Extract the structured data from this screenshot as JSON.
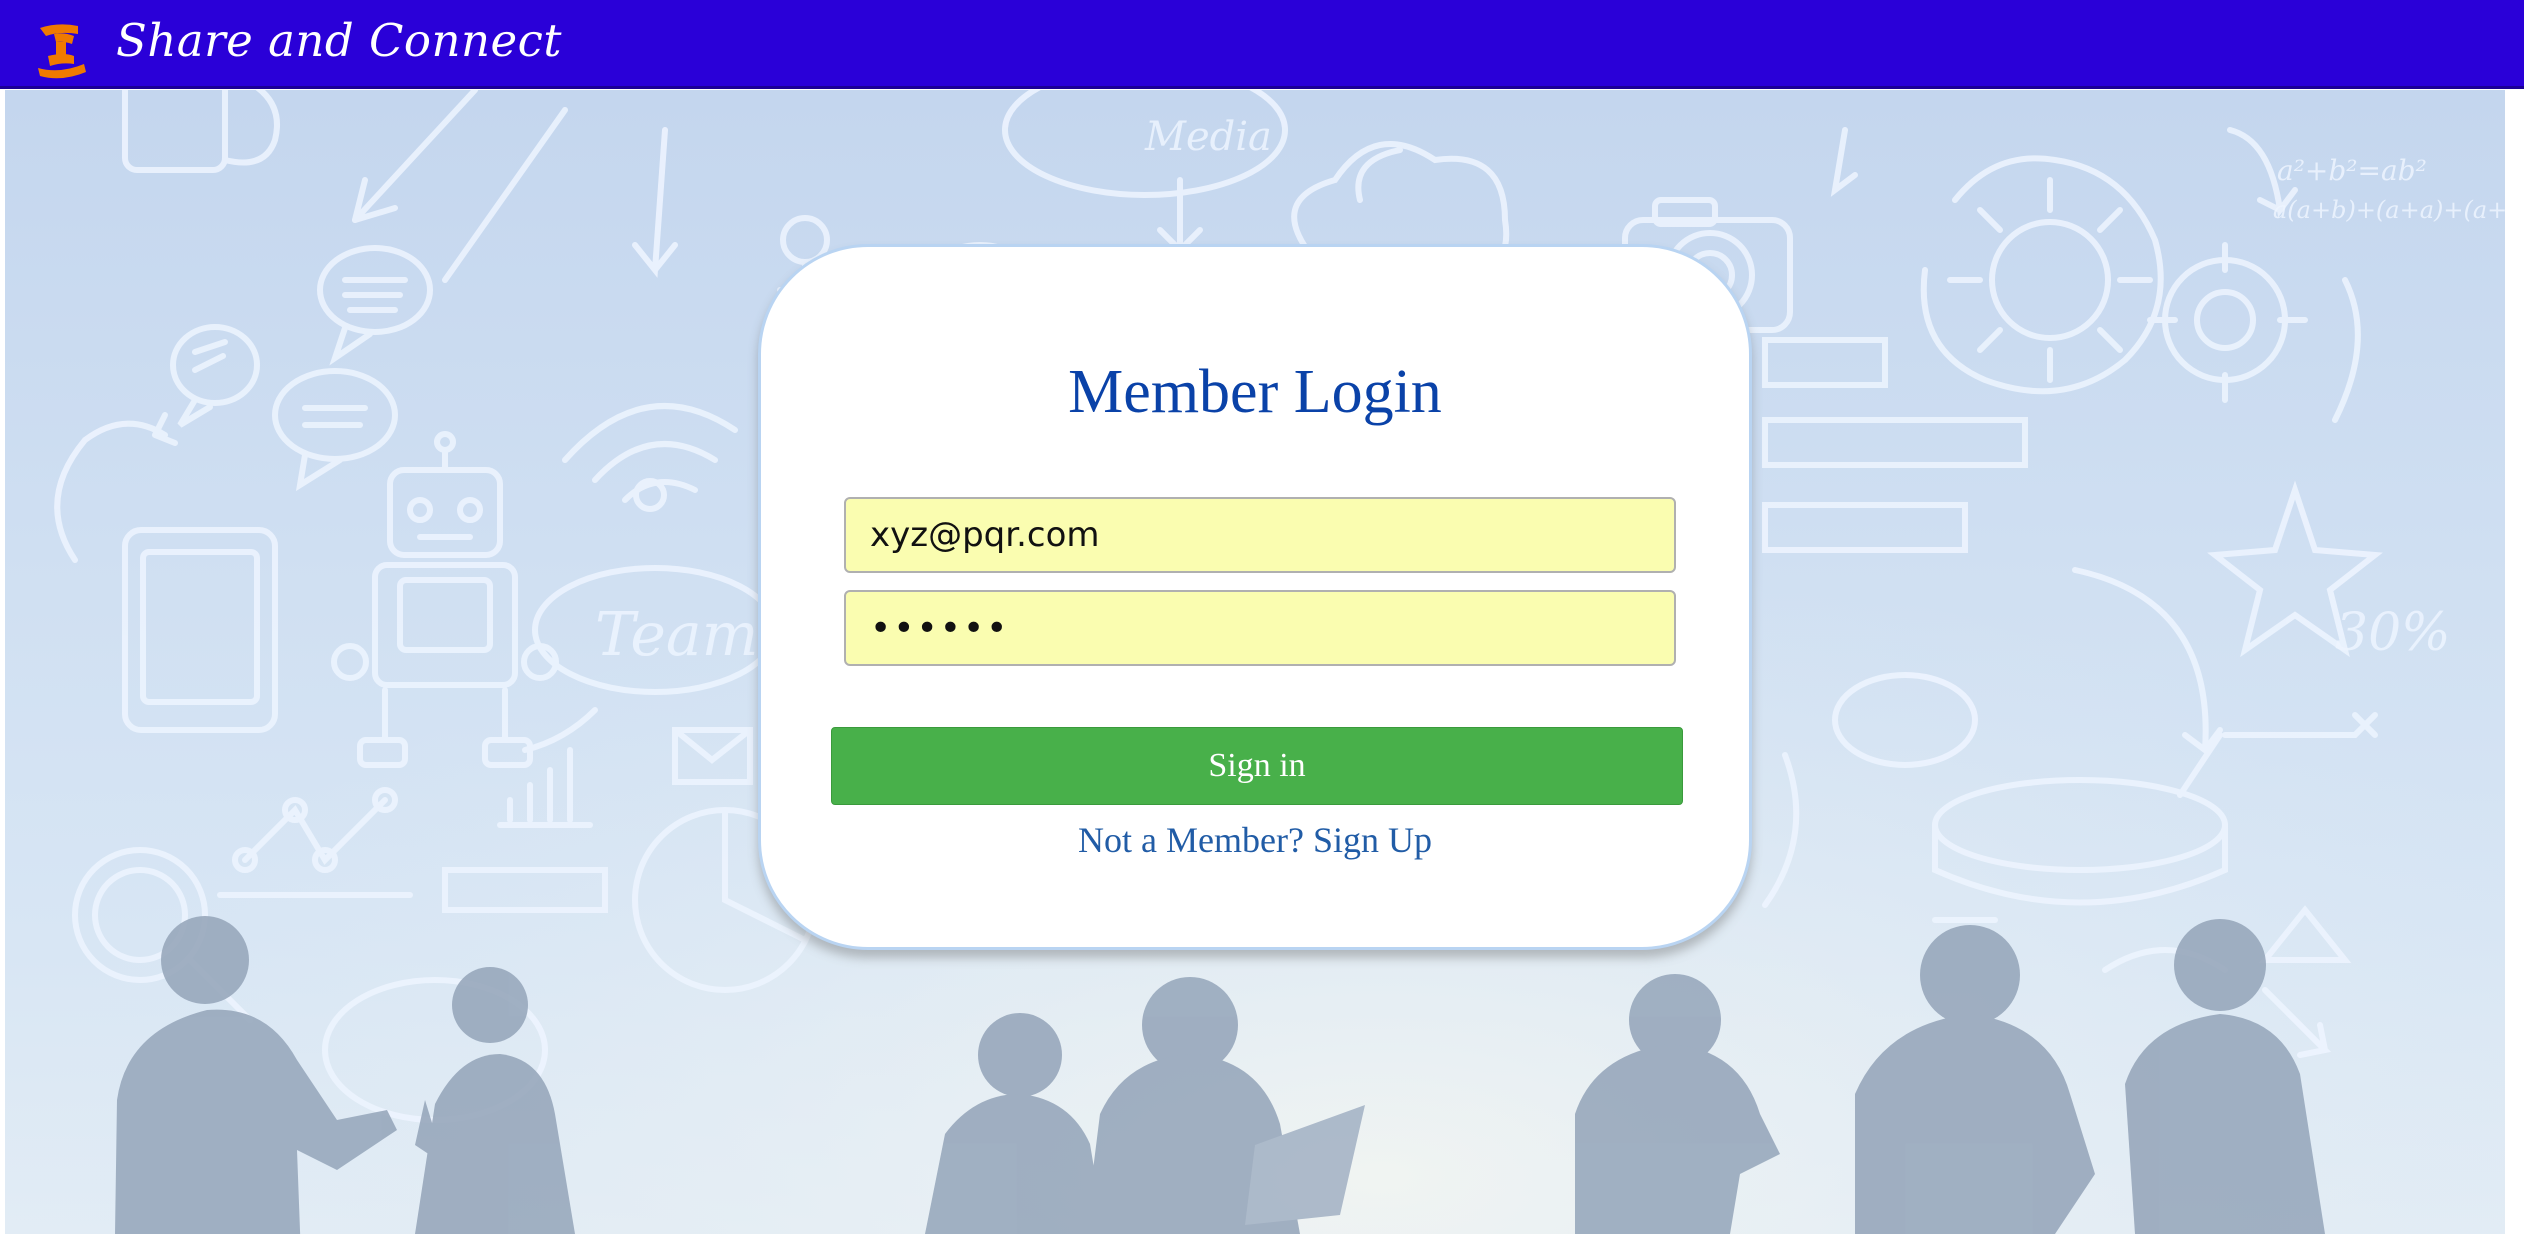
{
  "header": {
    "brand_title": "Share and Connect",
    "logo_icon": "hands-share-icon",
    "background_color": "#2a00d8"
  },
  "background": {
    "doodle_text": "Teamw",
    "speech_text": "Media",
    "formula_line1": "a²+b²=ab²",
    "formula_line2": "a(a+b)+(a+a)+(a+b)",
    "percent_text": "30%"
  },
  "login": {
    "title": "Member Login",
    "email_value": "xyz@pqr.com",
    "password_value": "••••••",
    "signin_label": "Sign in",
    "signup_label": "Not a Member? Sign Up"
  },
  "colors": {
    "title_blue": "#0a42a8",
    "input_fill": "#fafdb0",
    "signin_green": "#48b04a",
    "link_blue": "#215ca6"
  }
}
